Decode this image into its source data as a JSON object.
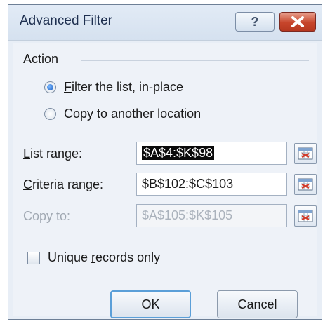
{
  "window": {
    "title": "Advanced Filter",
    "help_glyph": "?",
    "close_glyph": "X"
  },
  "action": {
    "section_label": "Action",
    "options": [
      {
        "label_prefix": "",
        "label_accesskey": "F",
        "label_suffix": "ilter the list, in-place",
        "checked": true
      },
      {
        "label_prefix": "C",
        "label_accesskey": "o",
        "label_suffix": "py to another location",
        "checked": false
      }
    ]
  },
  "fields": {
    "list_range": {
      "label_accesskey": "L",
      "label_suffix": "ist range:",
      "value": "$A$4:$K$98",
      "selected": true,
      "enabled": true
    },
    "criteria_range": {
      "label_accesskey": "C",
      "label_suffix": "riteria range:",
      "value": "$B$102:$C$103",
      "enabled": true
    },
    "copy_to": {
      "label": "Copy to:",
      "value": "$A$105:$K$105",
      "enabled": false
    }
  },
  "unique": {
    "label_prefix": "Unique ",
    "label_accesskey": "r",
    "label_suffix": "ecords only",
    "checked": false
  },
  "buttons": {
    "ok": "OK",
    "cancel": "Cancel"
  },
  "icons": {
    "help": "help-icon",
    "close": "close-icon",
    "range_selector": "collapse-dialog-icon"
  },
  "colors": {
    "close_button": "#c7452b",
    "ok_border": "#5b9fd8",
    "selection": "#0b0b0b"
  }
}
